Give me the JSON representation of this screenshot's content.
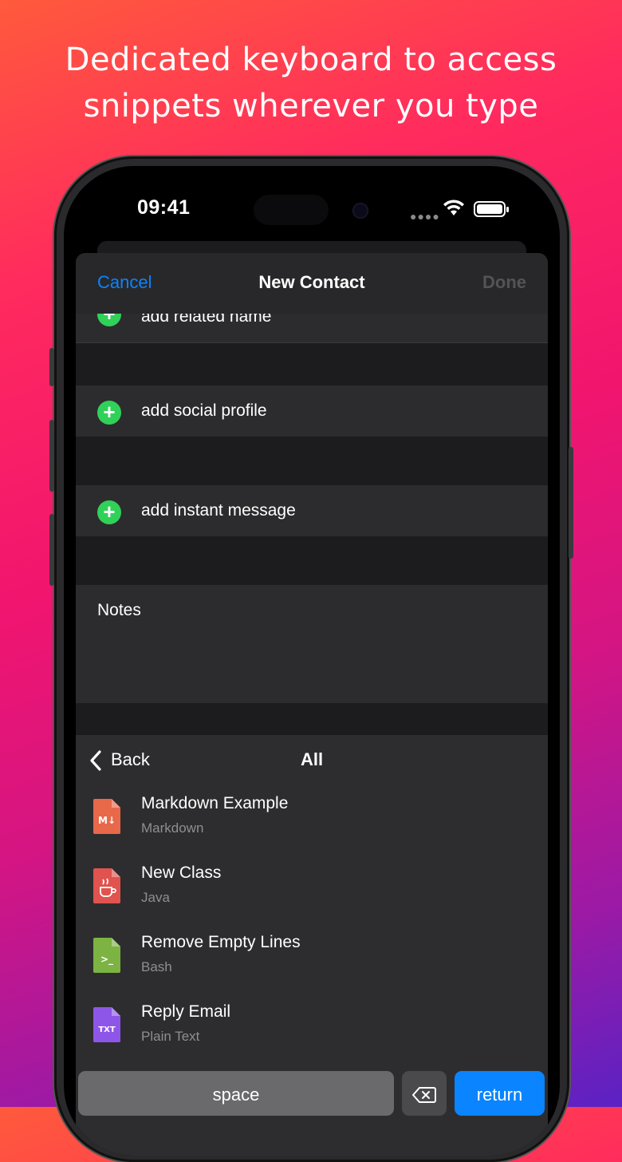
{
  "headline": {
    "line1": "Dedicated keyboard to access",
    "line2": "snippets wherever you type"
  },
  "status_bar": {
    "time": "09:41",
    "signal_icon": "signal-dots-icon",
    "wifi_icon": "wifi-icon",
    "battery_icon": "battery-icon"
  },
  "nav": {
    "cancel": "Cancel",
    "title": "New Contact",
    "done": "Done"
  },
  "rows": {
    "related_name": "add related name",
    "social_profile": "add social profile",
    "instant_message": "add instant message"
  },
  "notes": {
    "label": "Notes"
  },
  "keyboard": {
    "back": "Back",
    "title": "All",
    "snippets": [
      {
        "name": "Markdown Example",
        "language": "Markdown",
        "icon": "markdown-file-icon",
        "badge": "M↓",
        "color": "#e8684a"
      },
      {
        "name": "New Class",
        "language": "Java",
        "icon": "java-file-icon",
        "badge": "",
        "color": "#e0534f"
      },
      {
        "name": "Remove Empty Lines",
        "language": "Bash",
        "icon": "bash-file-icon",
        "badge": ">_",
        "color": "#7cb342"
      },
      {
        "name": "Reply Email",
        "language": "Plain Text",
        "icon": "text-file-icon",
        "badge": "TXT",
        "color": "#8e56e8"
      }
    ],
    "space": "space",
    "delete_icon": "delete-backspace-icon",
    "return": "return"
  },
  "colors": {
    "accent": "#0a84ff",
    "add_green": "#30d158"
  }
}
